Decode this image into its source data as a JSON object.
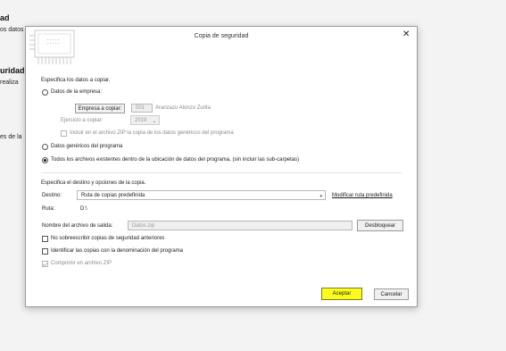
{
  "background": {
    "heading_1": "ad",
    "text_1": "os datos",
    "heading_2": "uridad",
    "text_2": "realiza",
    "text_3": "es de la"
  },
  "dialog": {
    "title": "Copia de seguridad",
    "close_glyph": "✕",
    "section1_title": "Especifica los datos a copiar.",
    "option_company": "Datos de la empresa:",
    "company_button": "Empresa a copiar:",
    "company_code": "001",
    "company_name": "Aranzazu Alonzo Zurita",
    "exercise_label": "Ejercicio a copiar:",
    "exercise_value": "2019",
    "include_zip_label": "Incluir en el archivo ZIP la copia de los datos genéricos del programa",
    "option_generic": "Datos genéricos del programa",
    "option_all": "Todos los archivos existentes dentro de la ubicación de datos del programa, (sin incluir las sub-carpetas)",
    "section2_title": "Especifica el destino y opciones de la copia.",
    "destination_label": "Destino:",
    "destination_value": "Ruta de copias predefinida",
    "modify_path_link": "Modificar ruta predefinida",
    "path_label": "Ruta:",
    "path_value": "D:\\",
    "output_name_label": "Nombre del archivo de salida:",
    "output_name_value": "Datos.zip",
    "unlock_button": "Desbloquear",
    "no_overwrite_label": "No sobreescribir copias de seguridad anteriores",
    "identify_label": "Identificar las copias con la denominación del programa",
    "compress_label": "Comprimir en archivo ZIP",
    "accept_button": "Aceptar",
    "cancel_button": "Cancelar"
  },
  "colors": {
    "accent_highlight": "#fbfb1e",
    "dialog_bg": "#ffffff",
    "page_bg": "#f3f3f3"
  }
}
